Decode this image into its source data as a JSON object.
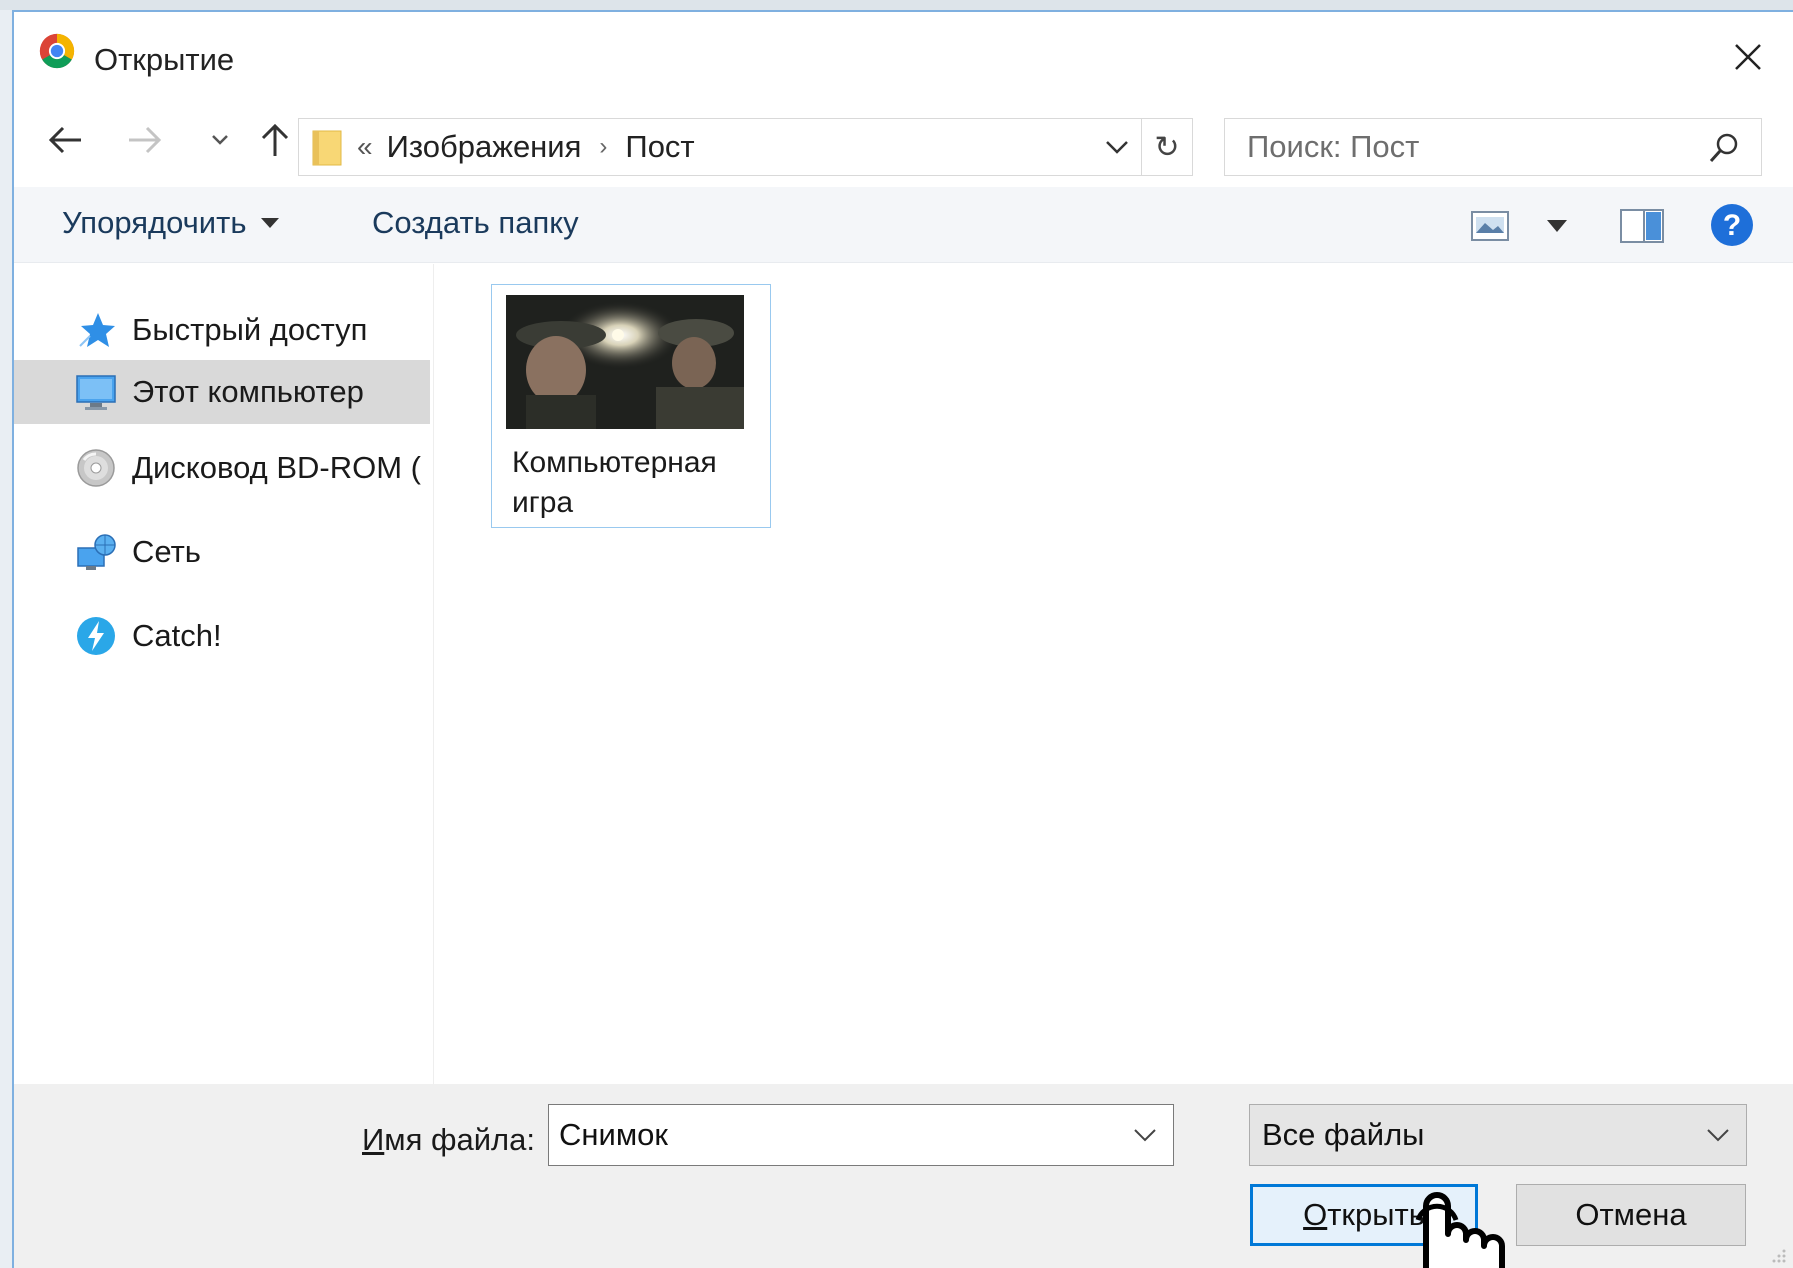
{
  "window": {
    "title": "Открытие",
    "close_label": "✕"
  },
  "nav": {
    "back_label": "←",
    "forward_label": "→",
    "recent_label": "⌄",
    "up_label": "↑",
    "breadcrumb_overflow": "«",
    "breadcrumbs": [
      "Изображения",
      "Пост"
    ],
    "refresh_label": "↻"
  },
  "search": {
    "placeholder": "Поиск: Пост"
  },
  "toolbar": {
    "organize_label": "Упорядочить",
    "new_folder_label": "Создать папку"
  },
  "sidebar": {
    "items": [
      {
        "label": "Быстрый доступ",
        "icon": "star-icon",
        "selected": false
      },
      {
        "label": "Этот компьютер",
        "icon": "computer-icon",
        "selected": true
      },
      {
        "label": "Дисковод BD-ROM (",
        "icon": "disc-icon",
        "selected": false
      },
      {
        "label": "Сеть",
        "icon": "network-icon",
        "selected": false
      },
      {
        "label": "Catch!",
        "icon": "catch-icon",
        "selected": false
      }
    ]
  },
  "files": [
    {
      "name": "Компьютерная игра",
      "type": "image"
    }
  ],
  "footer": {
    "filename_label_accel": "И",
    "filename_label_rest": "мя файла:",
    "filename_value": "Снимок",
    "filetype_value": "Все файлы",
    "open_accel": "О",
    "open_rest": "ткрыть",
    "cancel_label": "Отмена"
  },
  "colors": {
    "accent": "#0078d7",
    "selection": "#d9d9d9",
    "tile_border": "#99c9ef"
  }
}
